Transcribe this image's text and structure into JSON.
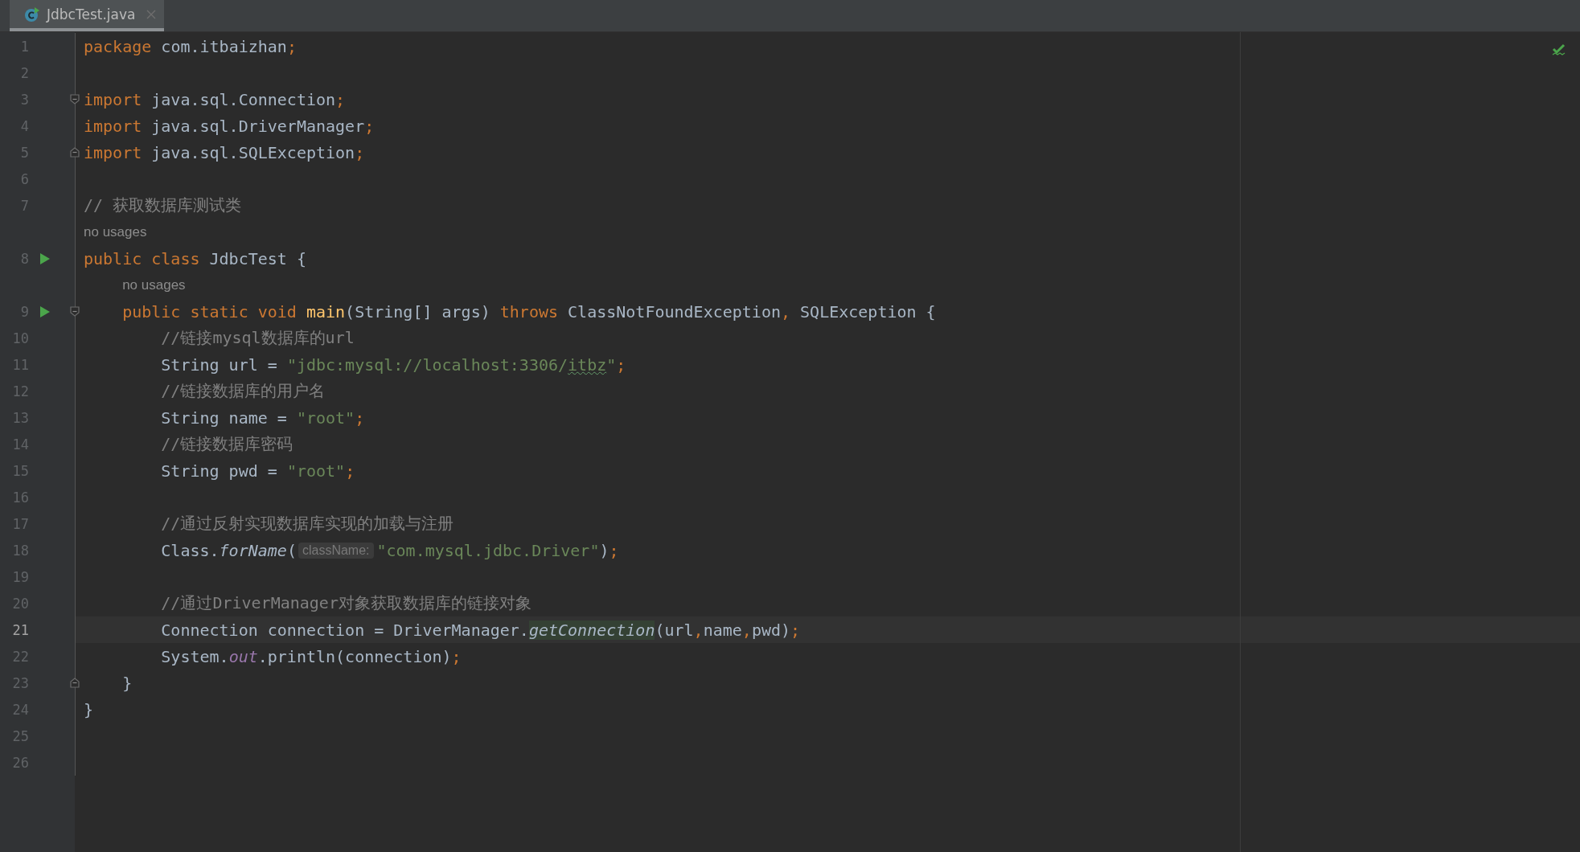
{
  "tab": {
    "title": "JdbcTest.java",
    "selected": true
  },
  "lines": [
    {
      "kind": "code",
      "number": "1",
      "run": false,
      "current": false,
      "tokens": [
        {
          "kind": "kw",
          "text": "package"
        },
        {
          "kind": "plain",
          "text": " com.itbaizhan"
        },
        {
          "kind": "kw",
          "text": ";"
        }
      ]
    },
    {
      "kind": "code",
      "number": "2",
      "run": false,
      "current": false
    },
    {
      "kind": "code",
      "number": "3",
      "run": false,
      "current": false,
      "fold_start": true,
      "tokens": [
        {
          "kind": "kw",
          "text": "import"
        },
        {
          "kind": "plain",
          "text": " java.sql.Connection"
        },
        {
          "kind": "kw",
          "text": ";"
        }
      ]
    },
    {
      "kind": "code",
      "number": "4",
      "run": false,
      "current": false,
      "tokens": [
        {
          "kind": "kw",
          "text": "import"
        },
        {
          "kind": "plain",
          "text": " java.sql.DriverManager"
        },
        {
          "kind": "kw",
          "text": ";"
        }
      ]
    },
    {
      "kind": "code",
      "number": "5",
      "run": false,
      "current": false,
      "fold_end": true,
      "tokens": [
        {
          "kind": "kw",
          "text": "import"
        },
        {
          "kind": "plain",
          "text": " java.sql.SQLException"
        },
        {
          "kind": "kw",
          "text": ";"
        }
      ]
    },
    {
      "kind": "code",
      "number": "6",
      "run": false,
      "current": false
    },
    {
      "kind": "code",
      "number": "7",
      "run": false,
      "current": false,
      "tokens": [
        {
          "kind": "comment",
          "text": "// 获取数据库测试类"
        }
      ]
    },
    {
      "kind": "hint",
      "text": "no usages"
    },
    {
      "kind": "code",
      "number": "8",
      "run": true,
      "current": false,
      "tokens": [
        {
          "kind": "kw",
          "text": "public class"
        },
        {
          "kind": "plain",
          "text": " JdbcTest {"
        }
      ],
      "children": [
        {
          "kind": "hint",
          "text": "no usages"
        },
        {
          "kind": "code",
          "number": "9",
          "run": true,
          "current": false,
          "fold_start": true,
          "tokens": [
            {
              "kind": "kw",
              "text": "public static void "
            },
            {
              "kind": "method",
              "text": "main"
            },
            {
              "kind": "plain",
              "text": "(String[] args) "
            },
            {
              "kind": "kw",
              "text": "throws "
            },
            {
              "kind": "plain",
              "text": "ClassNotFoundException"
            },
            {
              "kind": "kw",
              "text": ","
            },
            {
              "kind": "plain",
              "text": " SQLException {"
            }
          ],
          "children": [
            {
              "kind": "code",
              "number": "10",
              "run": false,
              "current": false,
              "tokens": [
                {
                  "kind": "comment",
                  "text": "//链接mysql数据库的url"
                }
              ]
            },
            {
              "kind": "code",
              "number": "11",
              "run": false,
              "current": false,
              "tokens": [
                {
                  "kind": "plain",
                  "text": "String url = "
                },
                {
                  "kind": "str",
                  "text": "\"jdbc:mysql://localhost:3306/"
                },
                {
                  "kind": "str",
                  "text": "itbz",
                  "typo": true
                },
                {
                  "kind": "str",
                  "text": "\""
                },
                {
                  "kind": "kw",
                  "text": ";"
                }
              ]
            },
            {
              "kind": "code",
              "number": "12",
              "run": false,
              "current": false,
              "tokens": [
                {
                  "kind": "comment",
                  "text": "//链接数据库的用户名"
                }
              ]
            },
            {
              "kind": "code",
              "number": "13",
              "run": false,
              "current": false,
              "tokens": [
                {
                  "kind": "plain",
                  "text": "String name = "
                },
                {
                  "kind": "str",
                  "text": "\"root\""
                },
                {
                  "kind": "kw",
                  "text": ";"
                }
              ]
            },
            {
              "kind": "code",
              "number": "14",
              "run": false,
              "current": false,
              "tokens": [
                {
                  "kind": "comment",
                  "text": "//链接数据库密码"
                }
              ]
            },
            {
              "kind": "code",
              "number": "15",
              "run": false,
              "current": false,
              "tokens": [
                {
                  "kind": "plain",
                  "text": "String pwd = "
                },
                {
                  "kind": "str",
                  "text": "\"root\""
                },
                {
                  "kind": "kw",
                  "text": ";"
                }
              ]
            },
            {
              "kind": "code",
              "number": "16",
              "run": false,
              "current": false
            },
            {
              "kind": "code",
              "number": "17",
              "run": false,
              "current": false,
              "tokens": [
                {
                  "kind": "comment",
                  "text": "//通过反射实现数据库实现的加载与注册"
                }
              ]
            },
            {
              "kind": "code",
              "number": "18",
              "run": false,
              "current": false,
              "tokens": [
                {
                  "kind": "plain",
                  "text": "Class."
                },
                {
                  "kind": "call",
                  "text": "forName"
                },
                {
                  "kind": "plain",
                  "text": "("
                },
                {
                  "kind": "inlay",
                  "text": "className:"
                },
                {
                  "kind": "str",
                  "text": "\"com.mysql.jdbc.Driver\""
                },
                {
                  "kind": "plain",
                  "text": ")"
                },
                {
                  "kind": "kw",
                  "text": ";"
                }
              ]
            },
            {
              "kind": "code",
              "number": "19",
              "run": false,
              "current": false
            },
            {
              "kind": "code",
              "number": "20",
              "run": false,
              "current": false,
              "tokens": [
                {
                  "kind": "comment",
                  "text": "//通过DriverManager对象获取数据库的链接对象"
                }
              ]
            },
            {
              "kind": "code",
              "number": "21",
              "run": false,
              "current": true,
              "tokens": [
                {
                  "kind": "plain",
                  "text": "Connection connection = DriverManager."
                },
                {
                  "kind": "call",
                  "text": "getConnection",
                  "highlighted": true
                },
                {
                  "kind": "plain",
                  "text": "(url"
                },
                {
                  "kind": "kw",
                  "text": ","
                },
                {
                  "kind": "plain",
                  "text": "name"
                },
                {
                  "kind": "kw",
                  "text": ","
                },
                {
                  "kind": "plain",
                  "text": "pwd)"
                },
                {
                  "kind": "kw",
                  "text": ";"
                }
              ]
            },
            {
              "kind": "code",
              "number": "22",
              "run": false,
              "current": false,
              "tokens": [
                {
                  "kind": "plain",
                  "text": "System."
                },
                {
                  "kind": "field",
                  "text": "out"
                },
                {
                  "kind": "plain",
                  "text": ".println(connection)"
                },
                {
                  "kind": "kw",
                  "text": ";"
                }
              ]
            }
          ]
        },
        {
          "kind": "code",
          "number": "23",
          "run": false,
          "current": false,
          "fold_end": true,
          "tokens": [
            {
              "kind": "plain",
              "text": "}"
            }
          ]
        }
      ]
    },
    {
      "kind": "code",
      "number": "24",
      "run": false,
      "current": false,
      "tokens": [
        {
          "kind": "plain",
          "text": "}"
        }
      ]
    },
    {
      "kind": "code",
      "number": "25",
      "run": false,
      "current": false
    },
    {
      "kind": "code",
      "number": "26",
      "run": false,
      "current": false
    }
  ]
}
